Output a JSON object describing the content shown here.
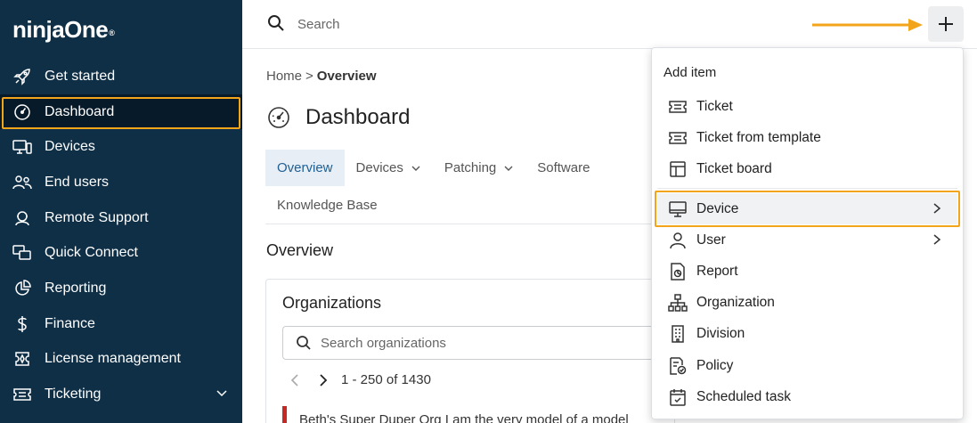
{
  "sidebar": {
    "logo": "ninjaOne",
    "logo_mark": "®",
    "items": [
      {
        "label": "Get started",
        "icon": "rocket-icon"
      },
      {
        "label": "Dashboard",
        "icon": "gauge-icon",
        "active": true
      },
      {
        "label": "Devices",
        "icon": "devices-icon"
      },
      {
        "label": "End users",
        "icon": "users-icon"
      },
      {
        "label": "Remote Support",
        "icon": "headset-icon"
      },
      {
        "label": "Quick Connect",
        "icon": "screens-icon"
      },
      {
        "label": "Reporting",
        "icon": "pie-chart-icon"
      },
      {
        "label": "Finance",
        "icon": "dollar-icon"
      },
      {
        "label": "License management",
        "icon": "license-icon"
      },
      {
        "label": "Ticketing",
        "icon": "ticket-icon",
        "expandable": true
      }
    ]
  },
  "topbar": {
    "search_placeholder": "Search",
    "add_button": "+"
  },
  "breadcrumb": {
    "home": "Home",
    "separator": ">",
    "current": "Overview"
  },
  "page": {
    "title": "Dashboard",
    "tabs": [
      "Overview",
      "Devices",
      "Patching",
      "Software"
    ],
    "tabs_row2": [
      "Knowledge Base"
    ],
    "section_title": "Overview"
  },
  "organizations": {
    "title": "Organizations",
    "search_placeholder": "Search organizations",
    "pager_text": "1 - 250 of 1430",
    "first_row": "Beth's Super Duper Org I am the very model of a model"
  },
  "menu": {
    "header": "Add item",
    "items": [
      {
        "label": "Ticket",
        "icon": "ticket-icon"
      },
      {
        "label": "Ticket from template",
        "icon": "ticket-icon"
      },
      {
        "label": "Ticket board",
        "icon": "board-icon"
      },
      {
        "label": "Device",
        "icon": "monitor-icon",
        "submenu": true,
        "highlighted": true
      },
      {
        "label": "User",
        "icon": "user-icon",
        "submenu": true
      },
      {
        "label": "Report",
        "icon": "report-icon"
      },
      {
        "label": "Organization",
        "icon": "org-icon"
      },
      {
        "label": "Division",
        "icon": "building-icon"
      },
      {
        "label": "Policy",
        "icon": "policy-icon"
      },
      {
        "label": "Scheduled task",
        "icon": "calendar-icon"
      }
    ]
  },
  "colors": {
    "sidebar_bg": "#0f2f47",
    "highlight": "#f2a51a",
    "tab_selected_text": "#1f5f93",
    "org_marker": "#c62828"
  }
}
